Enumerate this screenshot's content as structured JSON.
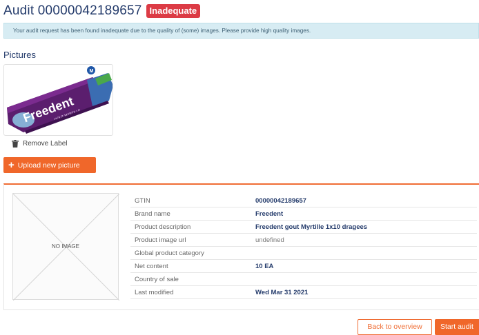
{
  "header": {
    "title": "Audit 00000042189657",
    "status_badge": "Inadequate"
  },
  "alert": {
    "message": "Your audit request has been found inadequate due to the quality of (some) images. Please provide high quality images."
  },
  "pictures": {
    "section_title": "Pictures",
    "remove_label": "Remove Label",
    "upload_button": "Upload new picture",
    "thumbnail_brand_text": "Freedent",
    "thumbnail_sub_text": "GOUT MYRTILLE"
  },
  "product": {
    "no_image_text": "NO IMAGE",
    "properties": [
      {
        "label": "GTIN",
        "value": "00000042189657",
        "muted": false
      },
      {
        "label": "Brand name",
        "value": "Freedent",
        "muted": false
      },
      {
        "label": "Product description",
        "value": "Freedent gout Myrtille 1x10 dragees",
        "muted": false
      },
      {
        "label": "Product image url",
        "value": "undefined",
        "muted": true
      },
      {
        "label": "Global product category",
        "value": "",
        "muted": false
      },
      {
        "label": "Net content",
        "value": "10 EA",
        "muted": false
      },
      {
        "label": "Country of sale",
        "value": "",
        "muted": false
      },
      {
        "label": "Last modified",
        "value": "Wed Mar 31 2021",
        "muted": false
      }
    ]
  },
  "actions": {
    "back_label": "Back to overview",
    "start_label": "Start audit"
  },
  "colors": {
    "accent": "#f0672a",
    "danger": "#dc3b45",
    "title": "#243b6b",
    "alert_bg": "#d7ecf3"
  }
}
